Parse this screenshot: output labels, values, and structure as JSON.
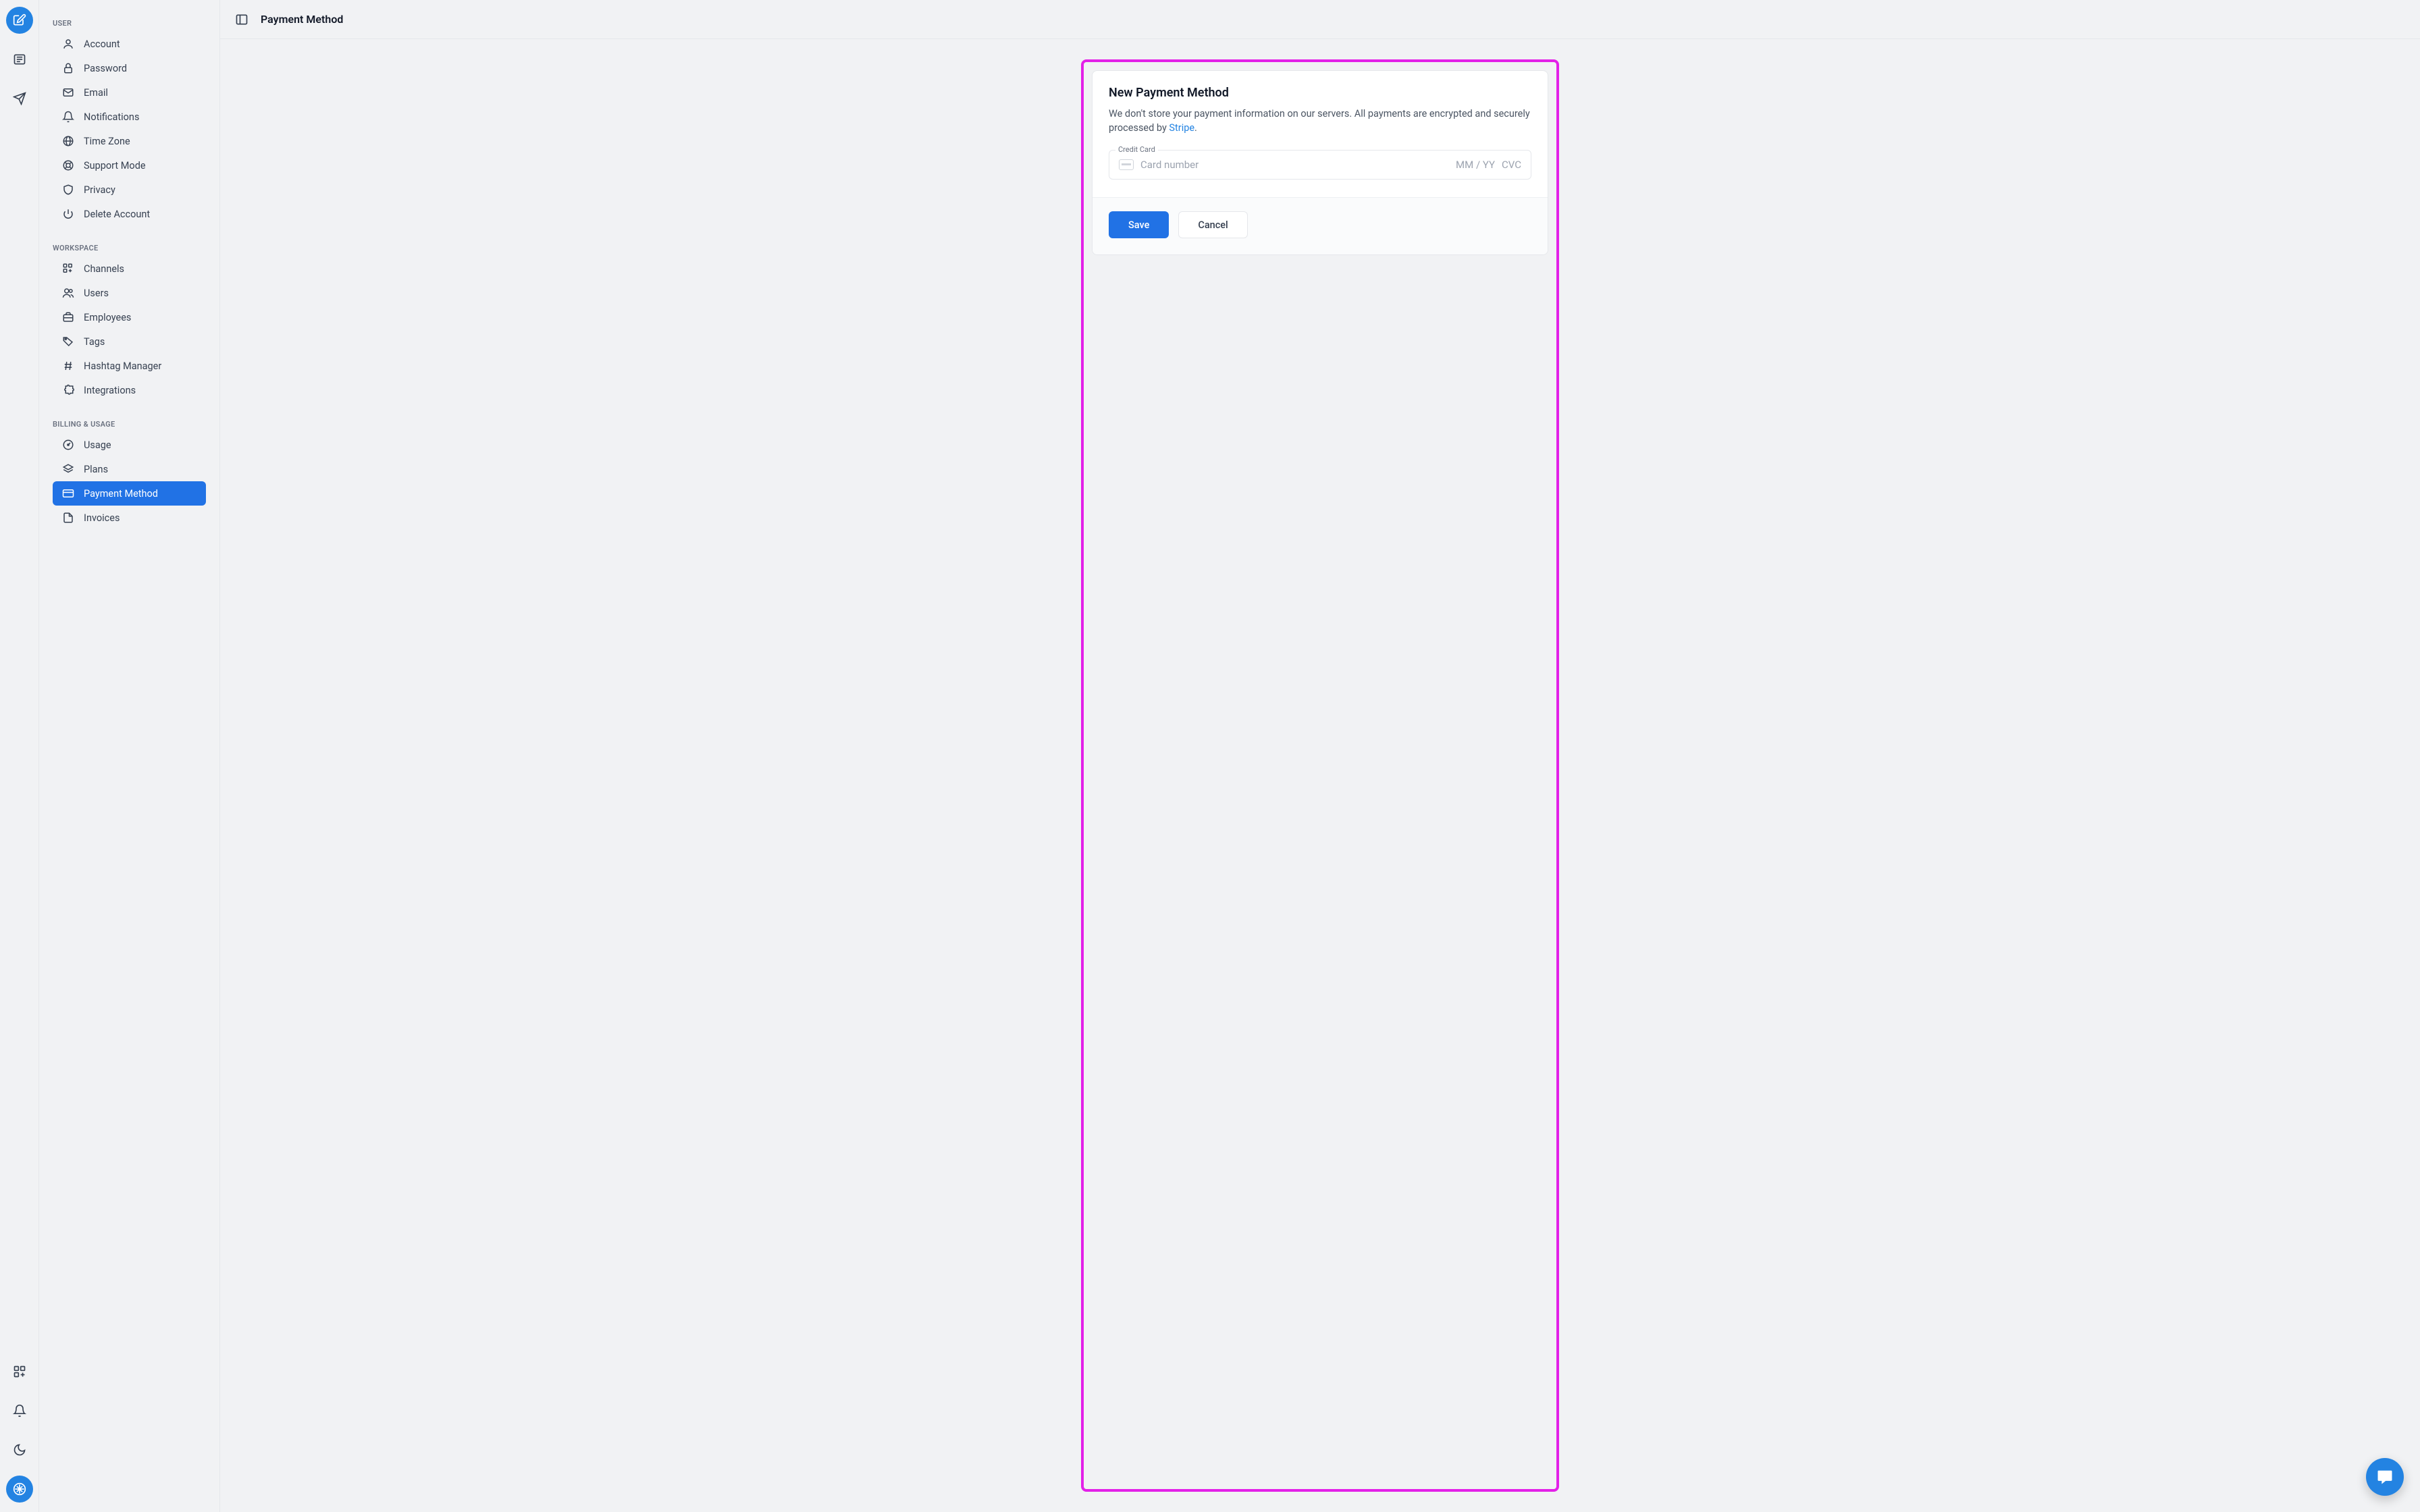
{
  "rail": {
    "compose": "compose",
    "news": "news",
    "send": "send",
    "apps": "apps",
    "alerts": "alerts",
    "theme": "theme",
    "logo": "logo"
  },
  "sidebar": {
    "sections": [
      {
        "label": "USER",
        "items": [
          {
            "icon": "user",
            "label": "Account"
          },
          {
            "icon": "lock",
            "label": "Password"
          },
          {
            "icon": "mail",
            "label": "Email"
          },
          {
            "icon": "bell",
            "label": "Notifications"
          },
          {
            "icon": "globe",
            "label": "Time Zone"
          },
          {
            "icon": "life-buoy",
            "label": "Support Mode"
          },
          {
            "icon": "shield",
            "label": "Privacy"
          },
          {
            "icon": "power",
            "label": "Delete Account"
          }
        ]
      },
      {
        "label": "WORKSPACE",
        "items": [
          {
            "icon": "grid-plus",
            "label": "Channels"
          },
          {
            "icon": "users",
            "label": "Users"
          },
          {
            "icon": "briefcase",
            "label": "Employees"
          },
          {
            "icon": "tag",
            "label": "Tags"
          },
          {
            "icon": "hash",
            "label": "Hashtag Manager"
          },
          {
            "icon": "puzzle",
            "label": "Integrations"
          }
        ]
      },
      {
        "label": "BILLING & USAGE",
        "items": [
          {
            "icon": "gauge",
            "label": "Usage"
          },
          {
            "icon": "layers",
            "label": "Plans"
          },
          {
            "icon": "credit-card",
            "label": "Payment Method",
            "active": true
          },
          {
            "icon": "file",
            "label": "Invoices"
          }
        ]
      }
    ]
  },
  "page": {
    "title": "Payment Method"
  },
  "form": {
    "card_title": "New Payment Method",
    "desc_pre": "We don't store your payment information on our servers. All payments are encrypted and securely processed by ",
    "link_text": "Stripe",
    "desc_post": ".",
    "field_label": "Credit Card",
    "placeholder_number": "Card number",
    "placeholder_exp": "MM / YY",
    "placeholder_cvc": "CVC",
    "save_label": "Save",
    "cancel_label": "Cancel"
  }
}
